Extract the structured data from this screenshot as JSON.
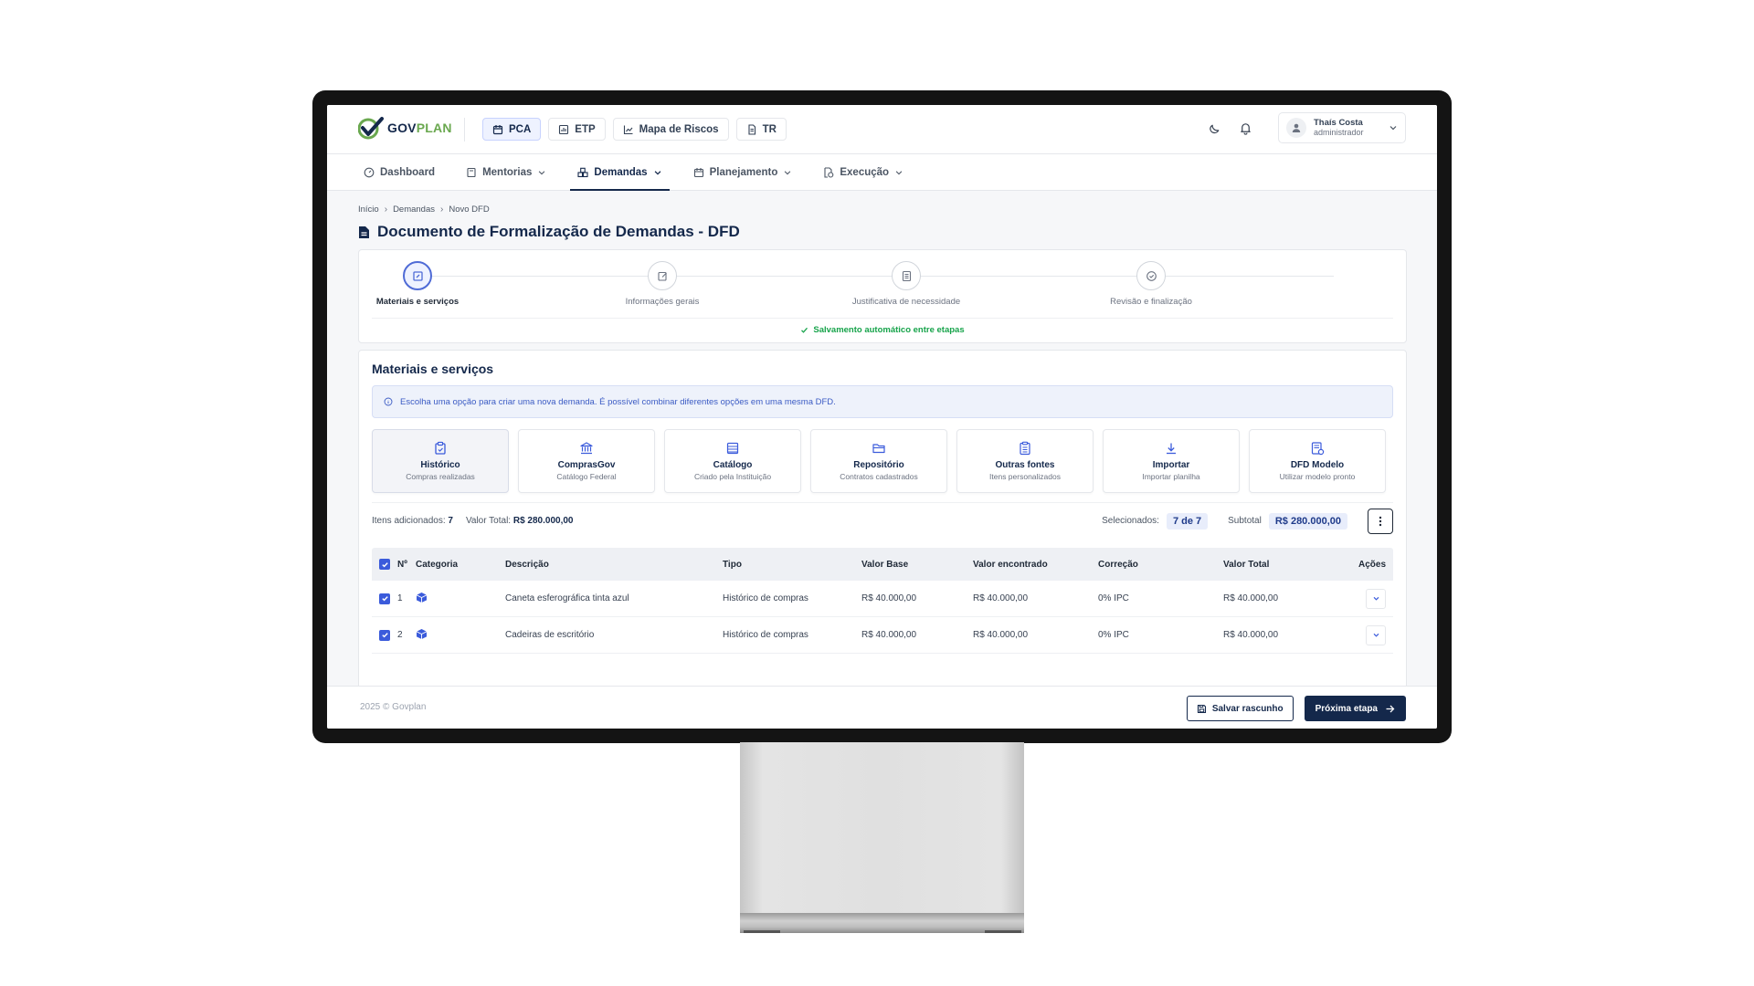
{
  "brand": {
    "gov": "GOV",
    "plan": "PLAN"
  },
  "modules": [
    {
      "label": "PCA",
      "icon": "calendar-icon",
      "active": true
    },
    {
      "label": "ETP",
      "icon": "chart-icon"
    },
    {
      "label": "Mapa de Riscos",
      "icon": "trend-icon"
    },
    {
      "label": "TR",
      "icon": "document-icon"
    }
  ],
  "user": {
    "name": "Thaís Costa",
    "role": "administrador"
  },
  "nav": [
    {
      "label": "Dashboard",
      "icon": "gauge-icon"
    },
    {
      "label": "Mentorias",
      "icon": "book-icon",
      "dropdown": true
    },
    {
      "label": "Demandas",
      "icon": "boxes-icon",
      "dropdown": true,
      "active": true
    },
    {
      "label": "Planejamento",
      "icon": "calendar-icon",
      "dropdown": true
    },
    {
      "label": "Execução",
      "icon": "file-clock-icon",
      "dropdown": true
    }
  ],
  "breadcrumb": [
    "Início",
    "Demandas",
    "Novo DFD"
  ],
  "page_title": "Documento de Formalização de Demandas - DFD",
  "steps": [
    {
      "label": "Materiais e serviços",
      "active": true
    },
    {
      "label": "Informações gerais"
    },
    {
      "label": "Justificativa de necessidade"
    },
    {
      "label": "Revisão e finalização"
    }
  ],
  "autosave": "Salvamento automático entre etapas",
  "materials": {
    "title": "Materiais e serviços",
    "info": "Escolha uma opção para criar uma nova demanda. É possível combinar diferentes opções em uma mesma DFD.",
    "options": [
      {
        "title": "Histórico",
        "sub": "Compras realizadas",
        "icon": "clipboard-icon",
        "active": true
      },
      {
        "title": "ComprasGov",
        "sub": "Catálogo Federal",
        "icon": "bank-icon"
      },
      {
        "title": "Catálogo",
        "sub": "Criado pela Instituição",
        "icon": "list-icon"
      },
      {
        "title": "Repositório",
        "sub": "Contratos cadastrados",
        "icon": "folder-icon"
      },
      {
        "title": "Outras fontes",
        "sub": "Itens personalizados",
        "icon": "clipboard-list-icon"
      },
      {
        "title": "Importar",
        "sub": "Importar planilha",
        "icon": "download-icon"
      },
      {
        "title": "DFD Modelo",
        "sub": "Utilizar modelo pronto",
        "icon": "template-icon"
      }
    ]
  },
  "summary": {
    "items_label": "Itens adicionados:",
    "items_value": "7",
    "total_label": "Valor Total:",
    "total_value": "R$ 280.000,00",
    "selected_label": "Selecionados:",
    "selected_value": "7 de 7",
    "subtotal_label": "Subtotal",
    "subtotal_value": "R$ 280.000,00"
  },
  "table": {
    "headers": [
      "Nº",
      "Categoria",
      "Descrição",
      "Tipo",
      "Valor Base",
      "Valor encontrado",
      "Correção",
      "Valor Total",
      "Ações"
    ],
    "rows": [
      {
        "n": "1",
        "desc": "Caneta esferográfica tinta azul",
        "tipo": "Histórico de compras",
        "vb": "R$ 40.000,00",
        "ve": "R$ 40.000,00",
        "cor": "0% IPC",
        "vt": "R$ 40.000,00"
      },
      {
        "n": "2",
        "desc": "Cadeiras de escritório",
        "tipo": "Histórico de compras",
        "vb": "R$ 40.000,00",
        "ve": "R$ 40.000,00",
        "cor": "0% IPC",
        "vt": "R$ 40.000,00"
      }
    ]
  },
  "footer": {
    "copyright": "2025 © Govplan",
    "save_label": "Salvar rascunho",
    "next_label": "Próxima etapa"
  },
  "colors": {
    "navy": "#14284b",
    "accent": "#3b5bdb",
    "green": "#16a34a",
    "brand_green": "#6aa84f"
  }
}
